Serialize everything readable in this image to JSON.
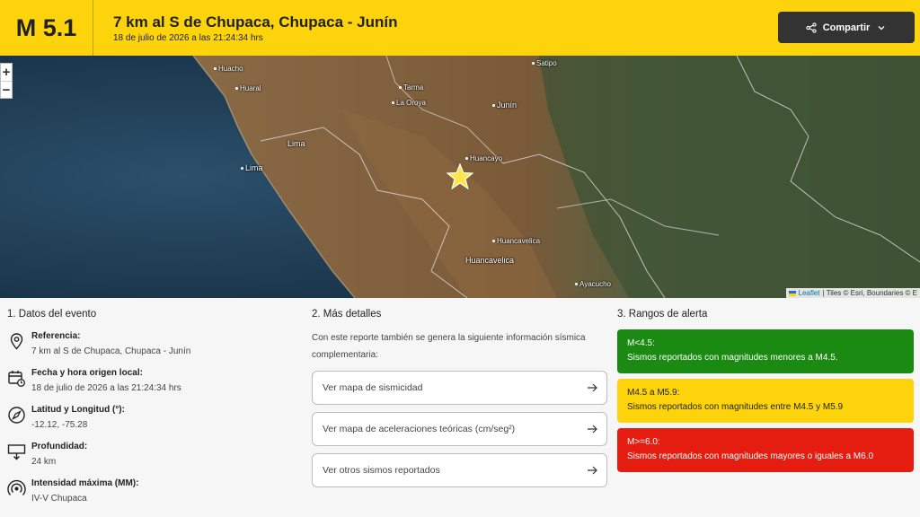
{
  "header": {
    "magnitude": "M 5.1",
    "title": "7 km al S de Chupaca, Chupaca - Junín",
    "subtitle": "18 de julio de 2026 a las 21:24:34 hrs",
    "share_label": "Compartir"
  },
  "map": {
    "zoom_in": "+",
    "zoom_out": "−",
    "cities": [
      "Huacho",
      "Huaral",
      "Lima",
      "Lima",
      "Tarma",
      "La Oroya",
      "Junín",
      "Satipo",
      "Huancayo",
      "Huancavelica",
      "Huancavelica",
      "Ayacucho"
    ],
    "attribution_leaflet": "Leaflet",
    "attribution_rest": "| Tiles © Esri, Boundaries © E"
  },
  "event": {
    "heading": "1. Datos del evento",
    "items": [
      {
        "label": "Referencia:",
        "value": "7 km al S de Chupaca, Chupaca - Junín",
        "icon": "location-pin-icon"
      },
      {
        "label": "Fecha y hora origen local:",
        "value": "18 de julio de 2026 a las 21:24:34 hrs",
        "icon": "calendar-clock-icon"
      },
      {
        "label": "Latitud y Longitud (°):",
        "value": "-12.12, -75.28",
        "icon": "compass-icon"
      },
      {
        "label": "Profundidad:",
        "value": "24 km",
        "icon": "depth-icon"
      },
      {
        "label": "Intensidad máxima (MM):",
        "value": "IV-V Chupaca",
        "icon": "intensity-icon"
      }
    ]
  },
  "details": {
    "heading": "2. Más detalles",
    "description": "Con este reporte también se genera la siguiente información sísmica complementaria:",
    "links": [
      "Ver mapa de sismicidad",
      "Ver mapa de aceleraciones teóricas (cm/seg²)",
      "Ver otros sismos reportados"
    ]
  },
  "alerts": {
    "heading": "3. Rangos de alerta",
    "ranges": [
      {
        "range": "M<4.5:",
        "text": "Sismos reportados con magnitudes menores a M4.5.",
        "color": "#1a8a12"
      },
      {
        "range": "M4.5 a M5.9:",
        "text": "Sismos reportados con magnitudes entre M4.5 y M5.9",
        "color": "#fdd40b"
      },
      {
        "range": "M>=6.0:",
        "text": "Sismos reportados con magnitudes mayores o iguales a M6.0",
        "color": "#e41d10"
      }
    ]
  }
}
